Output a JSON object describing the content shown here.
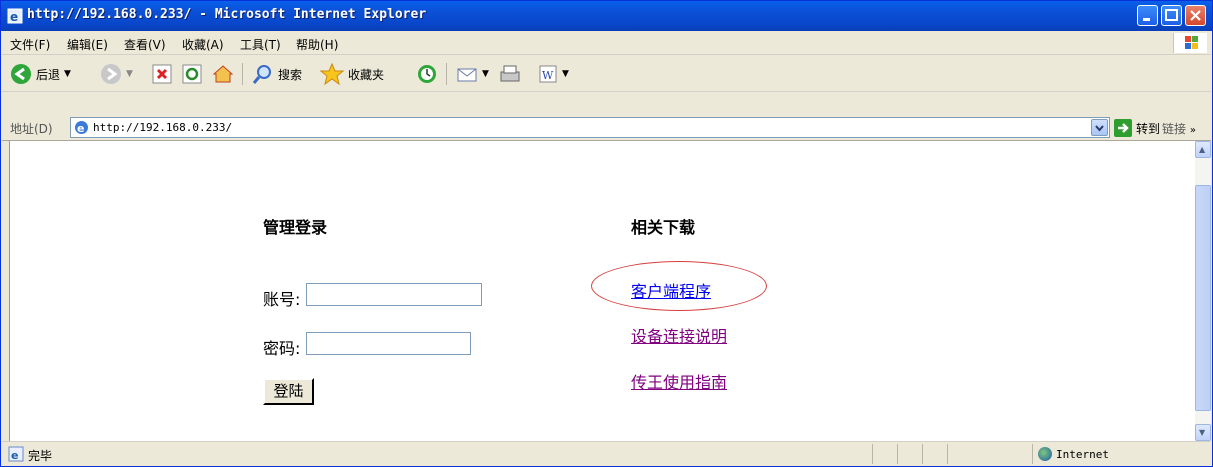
{
  "window": {
    "title": "http://192.168.0.233/ - Microsoft Internet Explorer"
  },
  "menu": {
    "items": [
      "文件(F)",
      "编辑(E)",
      "查看(V)",
      "收藏(A)",
      "工具(T)",
      "帮助(H)"
    ]
  },
  "toolbar": {
    "back_label": "后退",
    "search_label": "搜索",
    "favorites_label": "收藏夹"
  },
  "address": {
    "label": "地址(D)",
    "url": "http://192.168.0.233/",
    "go_label": "转到",
    "links_label": "链接"
  },
  "login": {
    "title": "管理登录",
    "account_label": "账号:",
    "password_label": "密码:",
    "account_value": "",
    "password_value": "",
    "submit_label": "登陆"
  },
  "downloads": {
    "title": "相关下载",
    "links": [
      "客户端程序",
      "设备连接说明",
      "传王使用指南"
    ]
  },
  "status": {
    "text": "完毕",
    "zone": "Internet"
  },
  "colors": {
    "titlebar": "#0a5fe8",
    "link_unvisited": "#0000ee",
    "link_visited": "#800080",
    "highlight_ellipse": "#d84040"
  }
}
